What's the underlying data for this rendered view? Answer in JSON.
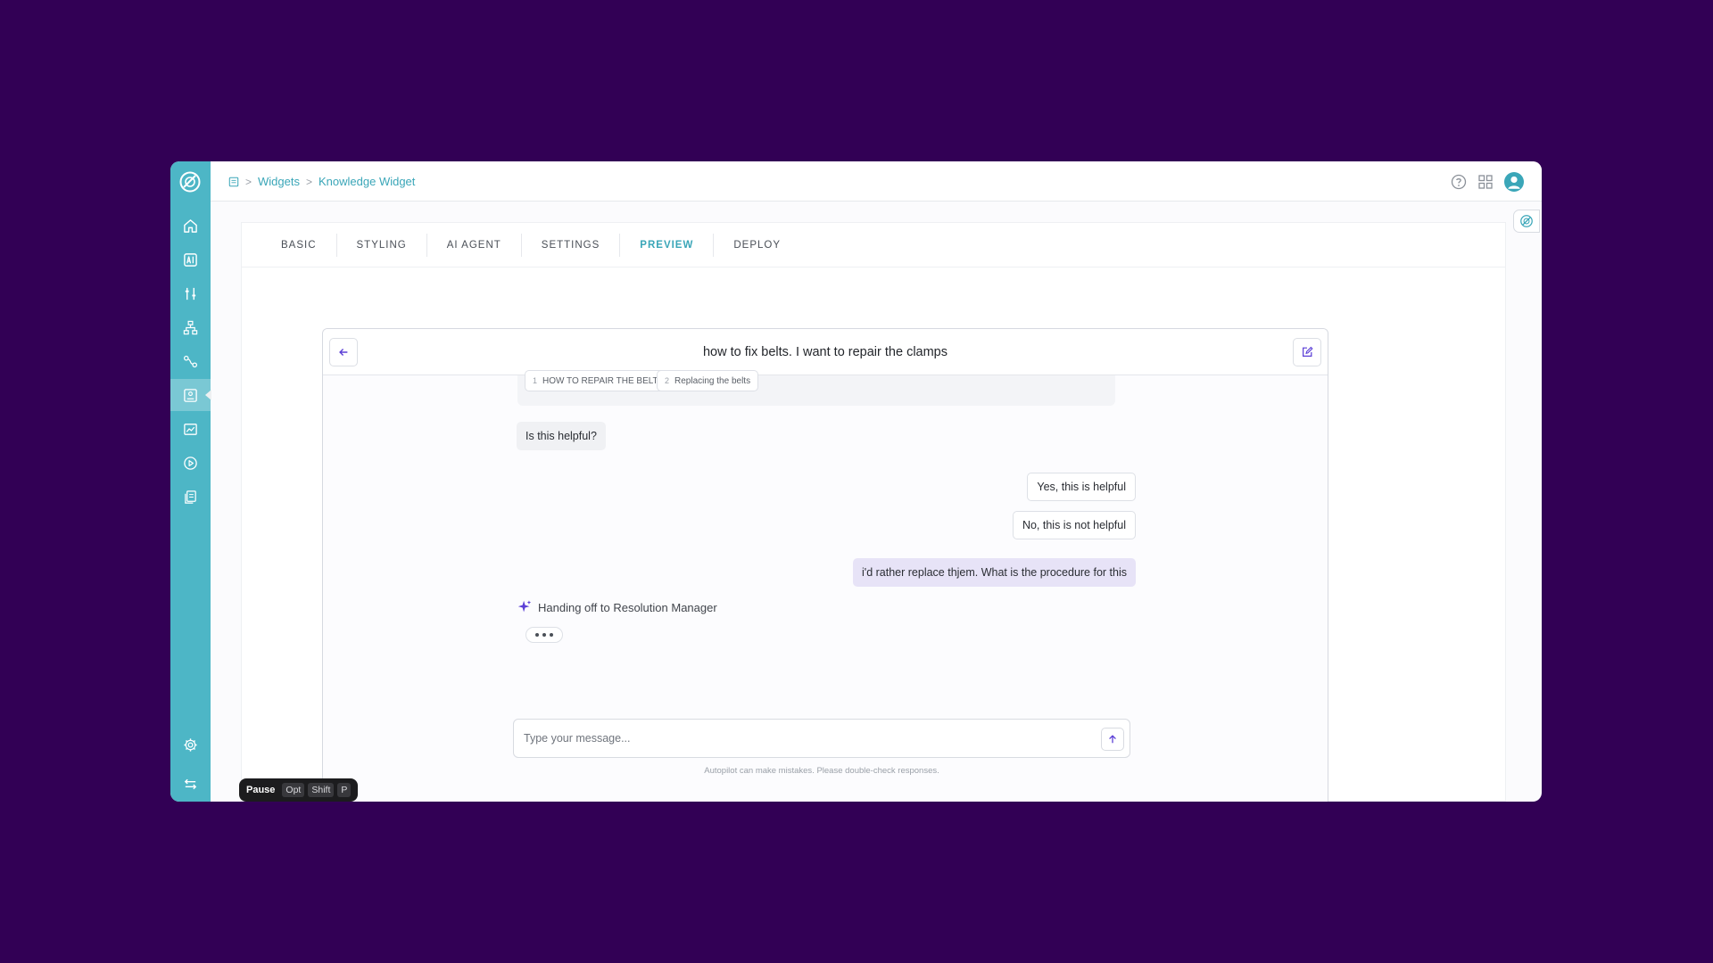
{
  "breadcrumb": {
    "items": [
      "Widgets",
      "Knowledge Widget"
    ]
  },
  "tabs": [
    {
      "label": "BASIC"
    },
    {
      "label": "STYLING"
    },
    {
      "label": "AI AGENT"
    },
    {
      "label": "SETTINGS"
    },
    {
      "label": "PREVIEW",
      "active": true
    },
    {
      "label": "DEPLOY"
    }
  ],
  "chat": {
    "title": "how to fix belts. I want to repair the clamps",
    "sources": [
      {
        "num": "1",
        "label": "HOW TO REPAIR THE BELT"
      },
      {
        "num": "2",
        "label": "Replacing the belts"
      }
    ],
    "helpful_question": "Is this helpful?",
    "option_yes": "Yes, this is helpful",
    "option_no": "No, this is not helpful",
    "user_message": "i'd rather replace thjem. What is the procedure for this",
    "handoff_text": "Handing off to Resolution Manager",
    "input_placeholder": "Type your message...",
    "disclaimer": "Autopilot can make mistakes. Please double-check responses."
  },
  "recording_bar": {
    "label": "Pause",
    "keys": [
      "Opt",
      "Shift",
      "P"
    ]
  },
  "colors": {
    "background": "#320055",
    "accent": "#3aa6b8",
    "sidebar": "#4db6c6",
    "user_bubble": "#e7e3f7",
    "sparkle": "#5b3fd6"
  },
  "icons": [
    "logo-icon",
    "home-icon",
    "ai-icon",
    "sliders-icon",
    "hierarchy-icon",
    "workflow-icon",
    "widget-icon",
    "analytics-icon",
    "play-icon",
    "documents-icon",
    "settings-icon",
    "collapse-icon",
    "help-icon",
    "apps-grid-icon",
    "user-icon",
    "back-arrow-icon",
    "edit-icon",
    "sparkle-icon",
    "send-icon"
  ]
}
